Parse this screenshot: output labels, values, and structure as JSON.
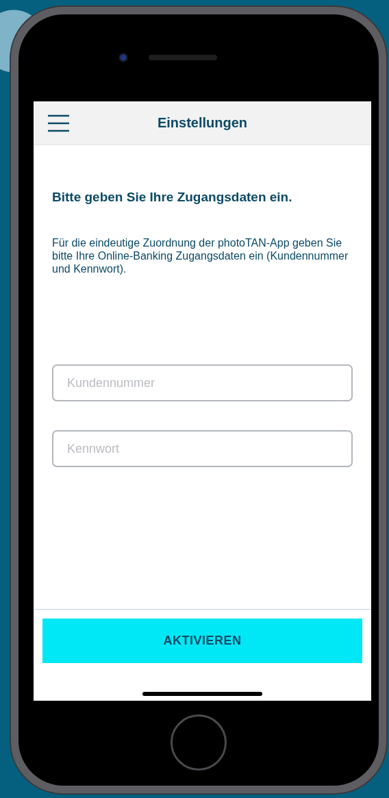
{
  "header": {
    "title": "Einstellungen"
  },
  "heading": "Bitte geben Sie Ihre Zugangsdaten ein.",
  "description": "Für die eindeutige Zuordnung der photoTAN-App geben Sie bitte Ihre Online-Banking Zugangsdaten ein (Kundennummer und Kennwort).",
  "fields": [
    {
      "placeholder": "Kundennummer"
    },
    {
      "placeholder": "Kennwort"
    }
  ],
  "button": {
    "label": "AKTIVIEREN"
  }
}
